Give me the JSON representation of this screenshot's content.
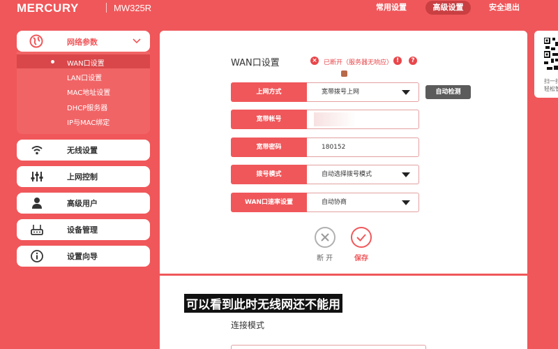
{
  "header": {
    "brand": "MERCURY",
    "model": "MW325R",
    "nav": [
      {
        "label": "常用设置",
        "active": false
      },
      {
        "label": "高级设置",
        "active": true
      },
      {
        "label": "安全退出",
        "active": false
      }
    ]
  },
  "sidebar": {
    "network": {
      "label": "网络参数",
      "icon": "globe-icon",
      "submenu": [
        "WAN口设置",
        "LAN口设置",
        "MAC地址设置",
        "DHCP服务器",
        "IP与MAC绑定"
      ]
    },
    "items": [
      {
        "label": "无线设置",
        "icon": "wifi-icon"
      },
      {
        "label": "上网控制",
        "icon": "sliders-icon"
      },
      {
        "label": "高级用户",
        "icon": "user-icon"
      },
      {
        "label": "设备管理",
        "icon": "router-icon"
      },
      {
        "label": "设置向导",
        "icon": "info-icon"
      }
    ]
  },
  "wan": {
    "title": "WAN口设置",
    "status": "已断开（服务器无响应）",
    "rows": [
      {
        "label": "上网方式",
        "value": "宽带拨号上网",
        "dropdown": true
      },
      {
        "label": "宽带帐号",
        "value": "",
        "dropdown": false
      },
      {
        "label": "宽带密码",
        "value": "180152",
        "dropdown": false
      },
      {
        "label": "拨号模式",
        "value": "自动选择拨号模式",
        "dropdown": true
      },
      {
        "label": "WAN口速率设置",
        "value": "自动协商",
        "dropdown": true
      }
    ],
    "auto_detect": "自动检测",
    "disconnect": "断 开",
    "save": "保存"
  },
  "qr": {
    "caption": "扫一扫\n轻松管"
  },
  "caption": "可以看到此时无线网还不能用",
  "section2": {
    "title": "连接模式"
  },
  "colors": {
    "primary": "#f0575a",
    "dark_button": "#5b5b5b"
  }
}
